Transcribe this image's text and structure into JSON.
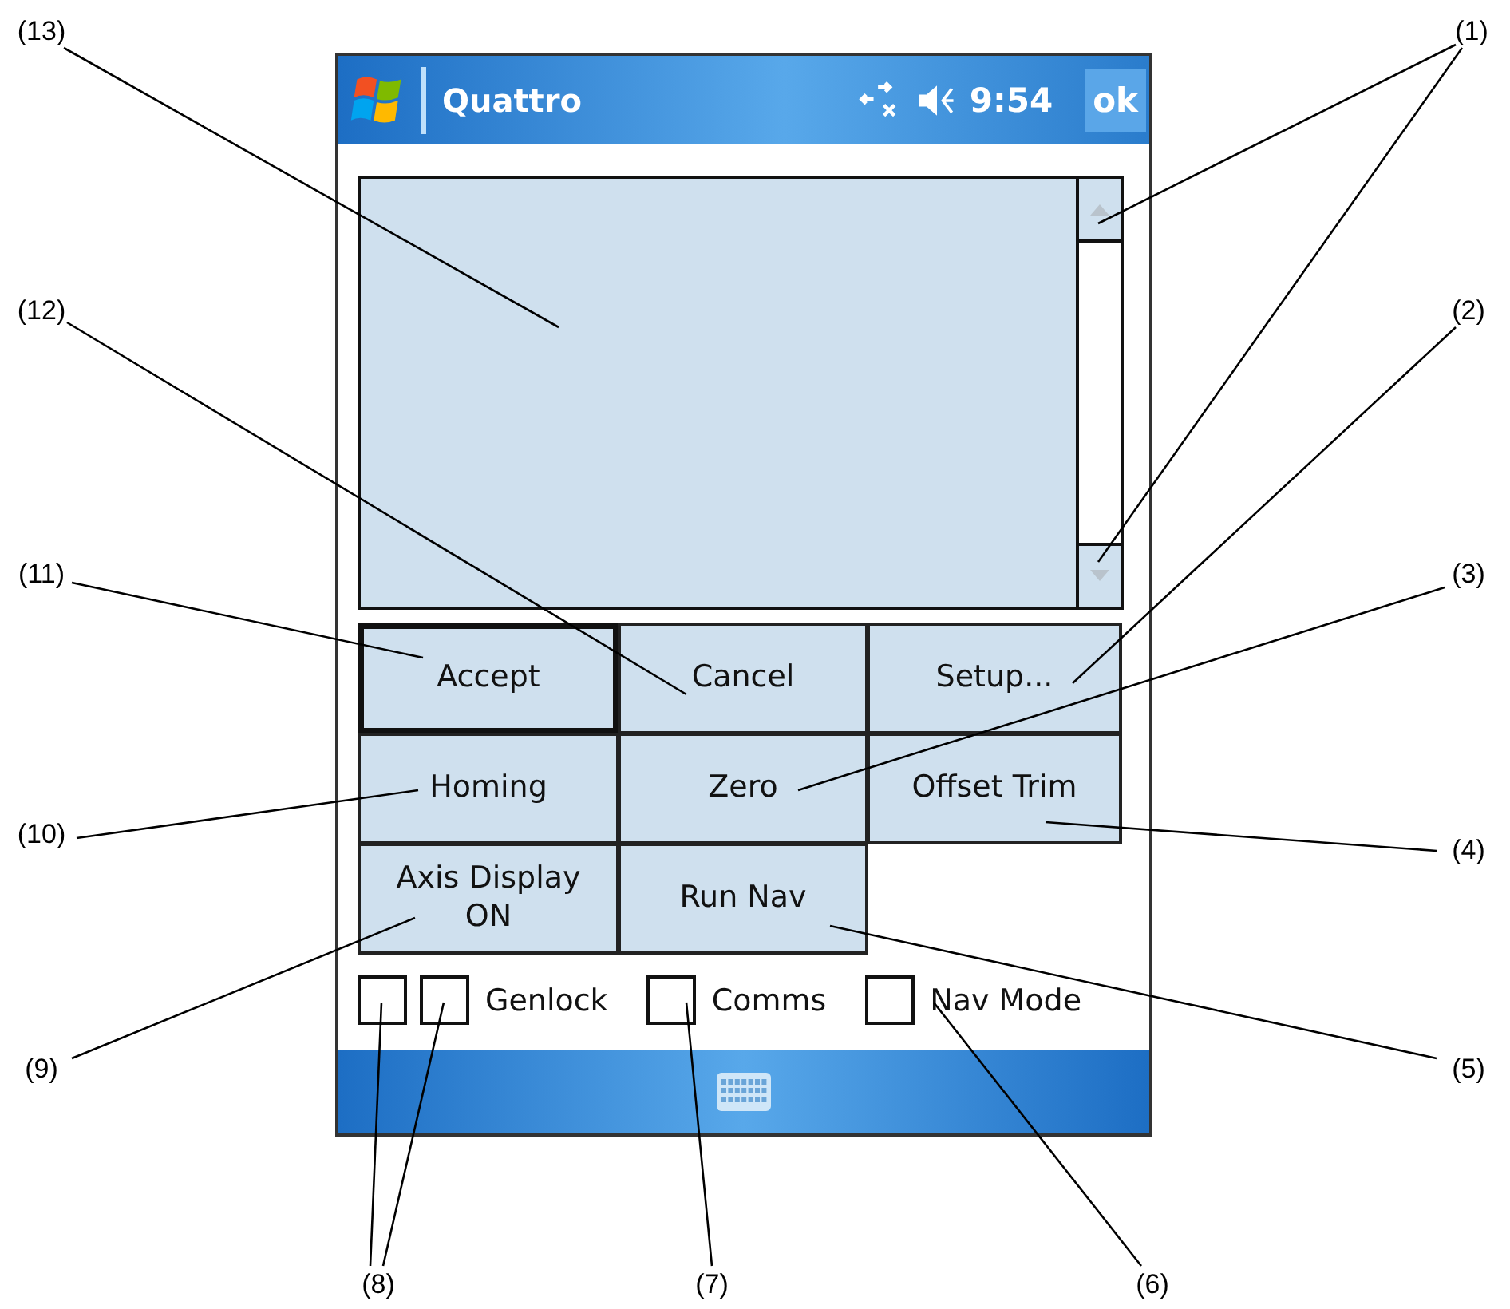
{
  "window": {
    "title": "Quattro",
    "time": "9:54",
    "ok_button": "ok"
  },
  "buttons": [
    {
      "label": "Accept",
      "default": true
    },
    {
      "label": "Cancel",
      "default": false
    },
    {
      "label": "Setup...",
      "default": false
    },
    {
      "label": "Homing",
      "default": false
    },
    {
      "label": "Zero",
      "default": false
    },
    {
      "label": "Offset Trim",
      "default": false
    },
    {
      "label": "Axis Display\nON",
      "default": false
    },
    {
      "label": "Run Nav",
      "default": false
    }
  ],
  "checkboxes": [
    {
      "checked": false
    },
    {
      "label": "Genlock",
      "checked": false
    },
    {
      "label": "Comms",
      "checked": false
    },
    {
      "label": "Nav Mode",
      "checked": false
    }
  ],
  "callouts": [
    "(13)",
    "(1)",
    "(12)",
    "(2)",
    "(11)",
    "(3)",
    "(10)",
    "(4)",
    "(9)",
    "(5)",
    "(8)",
    "(7)",
    "(6)"
  ]
}
